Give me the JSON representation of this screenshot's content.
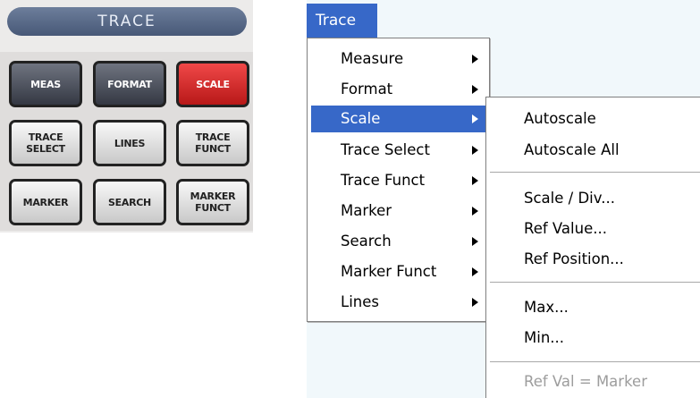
{
  "panel": {
    "title": "TRACE",
    "keys": [
      {
        "label": "MEAS",
        "style": "dark"
      },
      {
        "label": "FORMAT",
        "style": "dark"
      },
      {
        "label": "SCALE",
        "style": "red"
      },
      {
        "label": "TRACE\nSELECT",
        "style": "grey"
      },
      {
        "label": "LINES",
        "style": "grey"
      },
      {
        "label": "TRACE\nFUNCT",
        "style": "grey"
      },
      {
        "label": "MARKER",
        "style": "grey"
      },
      {
        "label": "SEARCH",
        "style": "grey"
      },
      {
        "label": "MARKER\nFUNCT",
        "style": "grey"
      }
    ]
  },
  "menubar": {
    "title": "Trace"
  },
  "trace_menu": {
    "items": [
      {
        "label": "Measure",
        "submenu": true
      },
      {
        "label": "Format",
        "submenu": true
      },
      {
        "label": "Scale",
        "submenu": true,
        "active": true
      },
      {
        "label": "Trace Select",
        "submenu": true
      },
      {
        "label": "Trace Funct",
        "submenu": true
      },
      {
        "label": "Marker",
        "submenu": true
      },
      {
        "label": "Search",
        "submenu": true
      },
      {
        "label": "Marker Funct",
        "submenu": true
      },
      {
        "label": "Lines",
        "submenu": true
      }
    ]
  },
  "scale_submenu": {
    "items": [
      {
        "label": "Autoscale"
      },
      {
        "label": "Autoscale All"
      },
      {
        "label": "Scale / Div..."
      },
      {
        "label": "Ref Value..."
      },
      {
        "label": "Ref Position..."
      },
      {
        "label": "Max..."
      },
      {
        "label": "Min..."
      },
      {
        "label": "Ref Val = Marker",
        "disabled": true
      }
    ]
  },
  "colors": {
    "menu_highlight": "#3768c8",
    "panel_header": "#475877",
    "scale_key": "#d82828"
  }
}
